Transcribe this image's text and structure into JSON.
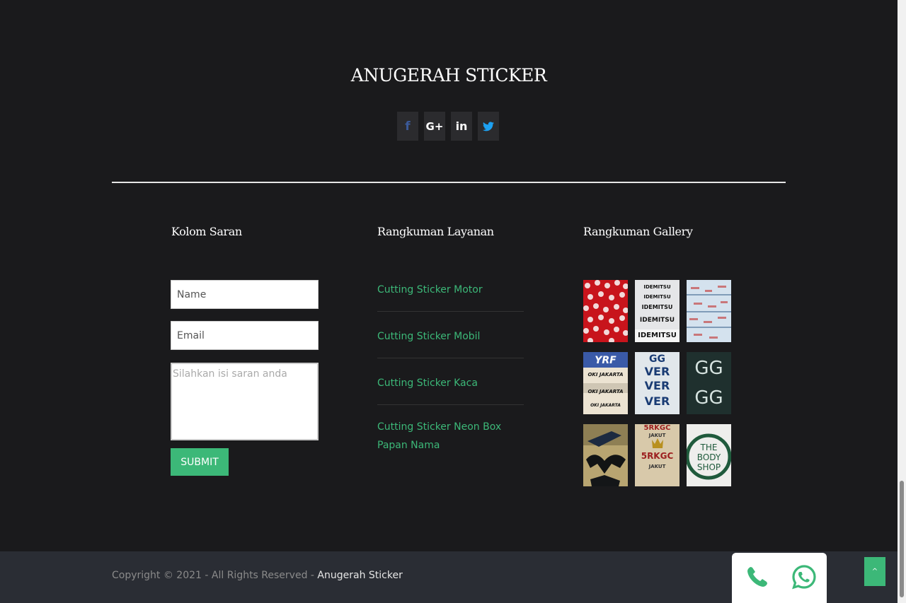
{
  "brand": {
    "title": "ANUGERAH STICKER"
  },
  "social": [
    {
      "name": "facebook-icon",
      "glyph": "f",
      "color": "#3b5998"
    },
    {
      "name": "google-plus-icon",
      "glyph": "G+",
      "color": "#ffffff"
    },
    {
      "name": "linkedin-icon",
      "glyph": "in",
      "color": "#ffffff"
    },
    {
      "name": "twitter-icon",
      "glyph": "t",
      "color": "#1da1f2"
    }
  ],
  "suggestion": {
    "title": "Kolom Saran",
    "name_placeholder": "Name",
    "email_placeholder": "Email",
    "message_placeholder": "Silahkan isi saran anda",
    "submit_label": "SUBMIT"
  },
  "services": {
    "title": "Rangkuman Layanan",
    "items": [
      "Cutting Sticker Motor",
      "Cutting Sticker Mobil",
      "Cutting Sticker Kaca",
      "Cutting Sticker Neon Box Papan Nama"
    ]
  },
  "gallery": {
    "title": "Rangkuman Gallery",
    "image_text": {
      "idemitsu": "IDEMITSU",
      "yrf": "YRF",
      "oki_jakarta": "OKI JAKARTA",
      "ver": "VER",
      "gg": "GG",
      "rkgc": "5RKGC",
      "jakut": "JAKUT",
      "body_shop": "THE BODY SHOP"
    }
  },
  "footer": {
    "copyright_prefix": "Copyright © 2021 - All Rights Reserved - ",
    "brand_link": "Anugerah Sticker"
  },
  "colors": {
    "accent": "#3cb878",
    "background": "#1a1a1c",
    "footer": "#2a2d34"
  }
}
